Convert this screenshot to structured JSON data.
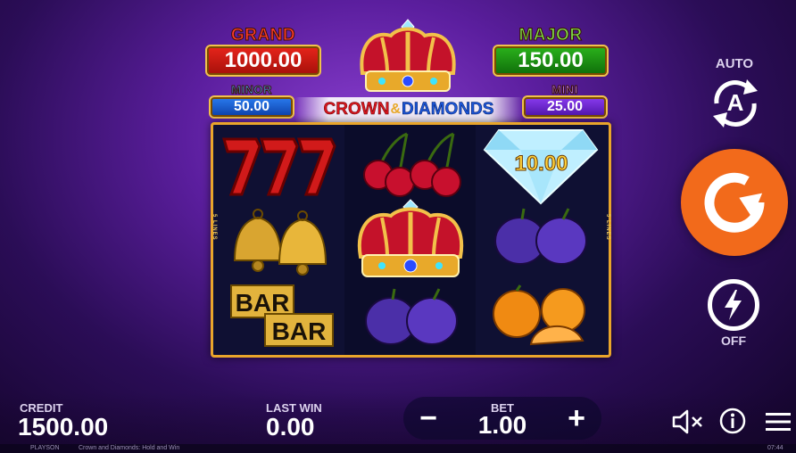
{
  "jackpots": {
    "grand": {
      "title": "GRAND",
      "value": "1000.00"
    },
    "major": {
      "title": "MAJOR",
      "value": "150.00"
    },
    "minor": {
      "title": "MINOR",
      "value": "50.00"
    },
    "mini": {
      "title": "MINI",
      "value": "25.00"
    }
  },
  "logo": {
    "part1": "CROWN",
    "amp": "&",
    "part2": "DIAMONDS"
  },
  "lines_label": "5 LINES",
  "reels": {
    "col1": [
      "seven-seven-seven",
      "bells",
      "bar-bar"
    ],
    "col2": [
      "cherries",
      "crown",
      "plums"
    ],
    "col3": [
      "diamond",
      "plums",
      "oranges"
    ],
    "diamond_value": "10.00"
  },
  "right_panel": {
    "auto_label": "AUTO",
    "auto_icon": "A",
    "turbo_label": "OFF"
  },
  "bottom_bar": {
    "credit_label": "CREDIT",
    "credit_value": "1500.00",
    "last_win_label": "LAST WIN",
    "last_win_value": "0.00",
    "bet_label": "BET",
    "bet_value": "1.00",
    "minus": "−",
    "plus": "+"
  },
  "footer": {
    "brand": "PLAYSON",
    "game_title": "Crown and Diamonds: Hold and Win",
    "clock": "07:44"
  },
  "colors": {
    "spin_button": "#f26a1b",
    "reel_frame": "#e9a52b"
  }
}
